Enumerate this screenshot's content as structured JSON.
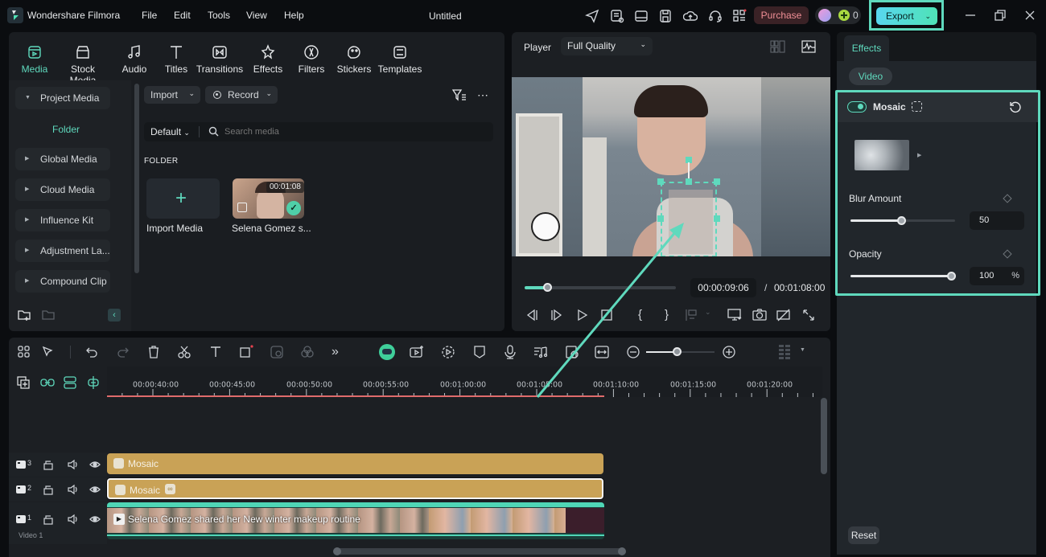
{
  "app": {
    "name": "Wondershare Filmora",
    "doc_title": "Untitled"
  },
  "menu": [
    "File",
    "Edit",
    "Tools",
    "View",
    "Help"
  ],
  "titlebar": {
    "icons": [
      "share-icon",
      "task-list-icon",
      "layout-icon",
      "save-icon",
      "cloud-upload-icon",
      "headset-support-icon",
      "apps-grid-icon"
    ],
    "purchase_label": "Purchase",
    "credits": "0",
    "export_label": "Export"
  },
  "media_tabs": [
    {
      "label": "Media",
      "icon": "media-icon",
      "active": true
    },
    {
      "label": "Stock Media",
      "icon": "stock-media-icon"
    },
    {
      "label": "Audio",
      "icon": "audio-note-icon"
    },
    {
      "label": "Titles",
      "icon": "titles-t-icon"
    },
    {
      "label": "Transitions",
      "icon": "transitions-icon"
    },
    {
      "label": "Effects",
      "icon": "effects-star-icon"
    },
    {
      "label": "Filters",
      "icon": "filters-icon"
    },
    {
      "label": "Stickers",
      "icon": "stickers-icon"
    },
    {
      "label": "Templates",
      "icon": "templates-icon"
    }
  ],
  "sidebar": {
    "project_media": "Project Media",
    "folder": "Folder",
    "items": [
      "Global Media",
      "Cloud Media",
      "Influence Kit",
      "Adjustment La...",
      "Compound Clip"
    ]
  },
  "media_toolbar": {
    "import_label": "Import",
    "record_label": "Record",
    "sort_label": "Default",
    "search_placeholder": "Search media",
    "folder_heading": "FOLDER"
  },
  "media_items": [
    {
      "label": "Import Media",
      "type": "import"
    },
    {
      "label": "Selena Gomez s...",
      "duration": "00:01:08",
      "added": true
    }
  ],
  "player": {
    "label": "Player",
    "quality": "Full Quality",
    "current_time": "00:00:09:06",
    "separator": "/",
    "total_time": "00:01:08:00",
    "progress_percent": 7.4
  },
  "effects_panel": {
    "tab": "Effects",
    "subtab": "Video",
    "effect_name": "Mosaic",
    "enabled": true,
    "params": [
      {
        "label": "Blur Amount",
        "value": "50",
        "unit": "",
        "fraction": 0.5
      },
      {
        "label": "Opacity",
        "value": "100",
        "unit": "%",
        "fraction": 1.0
      }
    ],
    "reset_label": "Reset"
  },
  "timeline": {
    "zoom_fraction": 0.45,
    "ruler_labels": [
      "00:00:40:00",
      "00:00:45:00",
      "00:00:50:00",
      "00:00:55:00",
      "00:01:00:00",
      "00:01:05:00",
      "00:01:10:00",
      "00:01:15:00",
      "00:01:20:00"
    ],
    "tracks": [
      {
        "index": "3",
        "clip_label": "Mosaic",
        "type": "effect"
      },
      {
        "index": "2",
        "clip_label": "Mosaic",
        "type": "effect",
        "selected": true
      },
      {
        "index": "1",
        "clip_label": "Selena Gomez shared her New winter makeup routine",
        "type": "video",
        "track_name": "Video 1"
      }
    ]
  }
}
